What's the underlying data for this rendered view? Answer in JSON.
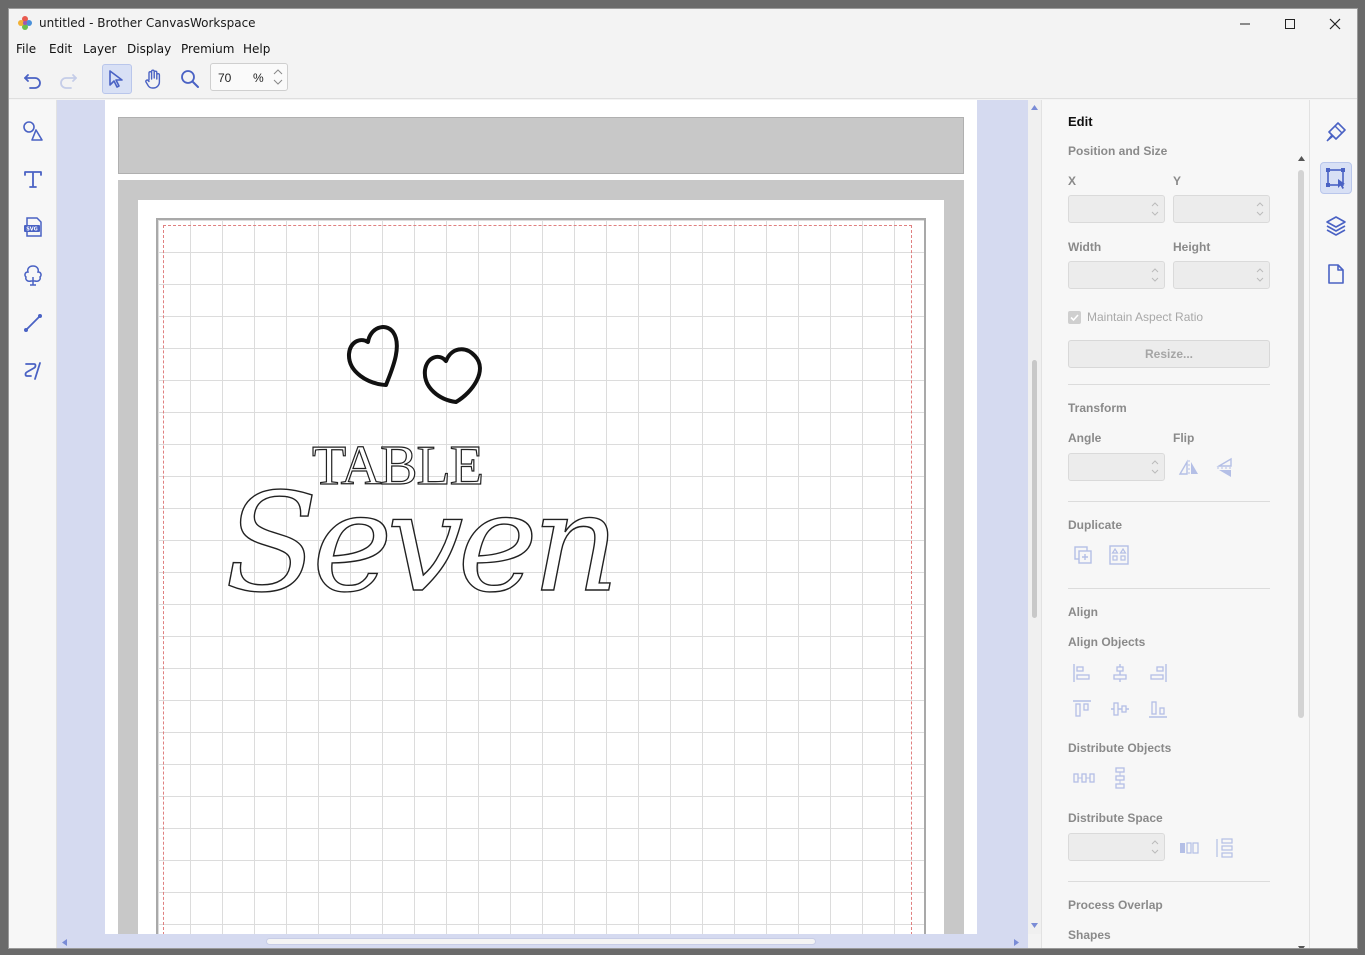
{
  "window": {
    "title": "untitled - Brother CanvasWorkspace"
  },
  "menu": {
    "items": [
      {
        "label": "File"
      },
      {
        "label": "Edit"
      },
      {
        "label": "Layer"
      },
      {
        "label": "Display"
      },
      {
        "label": "Premium"
      },
      {
        "label": "Help"
      }
    ]
  },
  "toolbar": {
    "zoom_value": "70",
    "zoom_unit": "%"
  },
  "left_tools": [
    "shapes-icon",
    "text-icon",
    "svg-icon",
    "tree-icon",
    "line-icon",
    "pen-icon"
  ],
  "canvas": {
    "text_line1": "TABLE",
    "text_line2": "Seven"
  },
  "panel": {
    "heading": "Edit",
    "position_size": "Position and Size",
    "x_label": "X",
    "y_label": "Y",
    "width_label": "Width",
    "height_label": "Height",
    "maintain_aspect": "Maintain Aspect Ratio",
    "resize_button": "Resize...",
    "transform": "Transform",
    "angle_label": "Angle",
    "flip_label": "Flip",
    "duplicate": "Duplicate",
    "align": "Align",
    "align_objects": "Align Objects",
    "distribute_objects": "Distribute Objects",
    "distribute_space": "Distribute Space",
    "process_overlap": "Process Overlap",
    "shapes": "Shapes"
  },
  "colors": {
    "accent": "#4a62c4",
    "canvas_bg": "#d5daf0"
  }
}
